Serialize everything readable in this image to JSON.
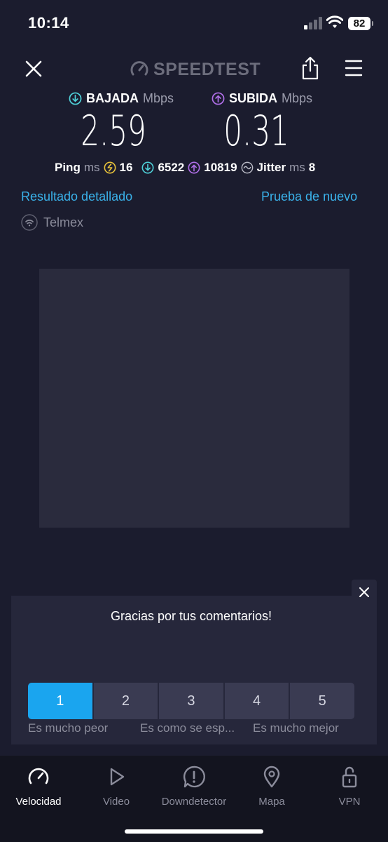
{
  "status_bar": {
    "time": "10:14",
    "battery": "82"
  },
  "header": {
    "logo_text": "SPEEDTEST",
    "close_icon": "close-icon",
    "share_icon": "share-icon",
    "menu_icon": "menu-icon"
  },
  "download": {
    "label": "BAJADA",
    "unit": "Mbps",
    "value": "2.59",
    "color": "#4fd1d9"
  },
  "upload": {
    "label": "SUBIDA",
    "unit": "Mbps",
    "value": "0.31",
    "color": "#b06fe8"
  },
  "stats": {
    "ping_label": "Ping",
    "ping_unit": "ms",
    "ping_value": "16",
    "down_value": "6522",
    "up_value": "10819",
    "jitter_label": "Jitter",
    "jitter_unit": "ms",
    "jitter_value": "8"
  },
  "links": {
    "detailed": "Resultado detallado",
    "retry": "Prueba de nuevo"
  },
  "isp": {
    "name": "Telmex"
  },
  "feedback": {
    "title": "Gracias por tus comentarios!",
    "options": [
      "1",
      "2",
      "3",
      "4",
      "5"
    ],
    "selected": "1",
    "label_low": "Es mucho peor",
    "label_mid": "Es como se esp...",
    "label_high": "Es mucho mejor"
  },
  "tabs": [
    {
      "label": "Velocidad",
      "icon": "speedometer-icon",
      "active": true
    },
    {
      "label": "Video",
      "icon": "play-icon",
      "active": false
    },
    {
      "label": "Downdetector",
      "icon": "alert-icon",
      "active": false
    },
    {
      "label": "Mapa",
      "icon": "map-pin-icon",
      "active": false
    },
    {
      "label": "VPN",
      "icon": "lock-icon",
      "active": false
    }
  ],
  "colors": {
    "accent": "#1aa5ef",
    "link": "#3ab2ea",
    "background": "#1b1c2e"
  }
}
